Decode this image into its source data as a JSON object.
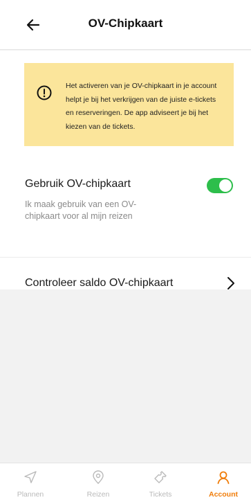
{
  "header": {
    "title": "OV-Chipkaart"
  },
  "notice": {
    "text": "Het activeren van je OV-chipkaart in je account helpt je bij het verkrijgen van de juiste e-tickets en reserveringen. De app adviseert je bij het kiezen van de tickets."
  },
  "toggle": {
    "label": "Gebruik OV-chipkaart",
    "description": "Ik maak gebruik van een OV-chipkaart voor al mijn reizen",
    "on": true
  },
  "balance": {
    "label": "Controleer saldo OV-chipkaart"
  },
  "tabs": [
    {
      "label": "Plannen",
      "icon": "navigation-arrow-icon",
      "active": false
    },
    {
      "label": "Reizen",
      "icon": "location-pin-icon",
      "active": false
    },
    {
      "label": "Tickets",
      "icon": "ticket-icon",
      "active": false
    },
    {
      "label": "Account",
      "icon": "person-icon",
      "active": true
    }
  ],
  "colors": {
    "accent": "#f07d0a",
    "toggle_on": "#2dbe4b",
    "notice_background": "#fbe59b",
    "inactive_tab": "#b9b9b9"
  }
}
